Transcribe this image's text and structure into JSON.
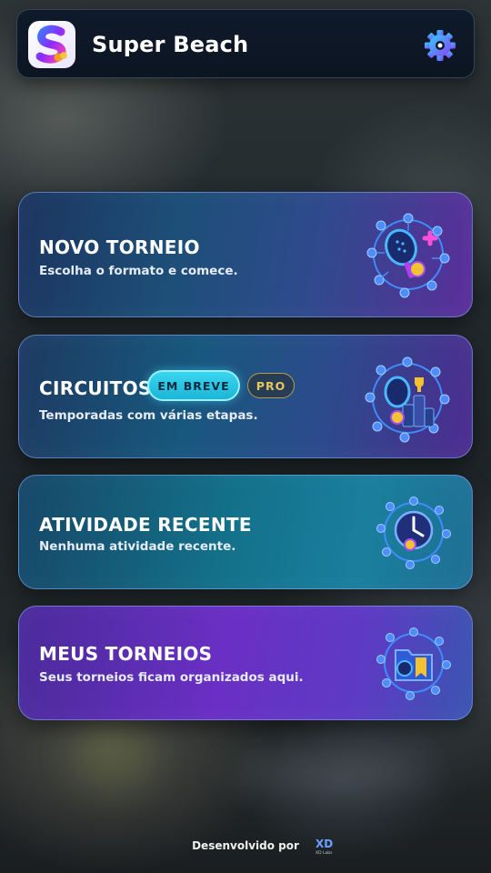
{
  "app": {
    "title": "Super Beach",
    "logo_letter": "S"
  },
  "header": {
    "settings_icon": "gear-icon"
  },
  "cards": [
    {
      "id": "novo-torneio",
      "title": "NOVO TORNEIO",
      "subtitle": "Escolha o formato e comece.",
      "icon": "padel-racket-plus-icon"
    },
    {
      "id": "circuitos",
      "title": "CIRCUITOS",
      "subtitle": "Temporadas com várias etapas.",
      "badges": [
        "EM BREVE",
        "PRO"
      ],
      "icon": "trophy-podium-icon"
    },
    {
      "id": "atividade-recente",
      "title": "ATIVIDADE RECENTE",
      "subtitle": "Nenhuma atividade recente.",
      "icon": "clock-history-icon"
    },
    {
      "id": "meus-torneios",
      "title": "MEUS TORNEIOS",
      "subtitle": "Seus torneios ficam organizados aqui.",
      "icon": "folder-bookmark-icon"
    }
  ],
  "footer": {
    "text": "Desenvolvido por",
    "logo_text": "XD",
    "logo_subtext": "XD Labs"
  },
  "colors": {
    "accent_cyan": "#3ad5ee",
    "pro_gold": "#e8c65a",
    "header_bg": "#0f1a2a"
  }
}
